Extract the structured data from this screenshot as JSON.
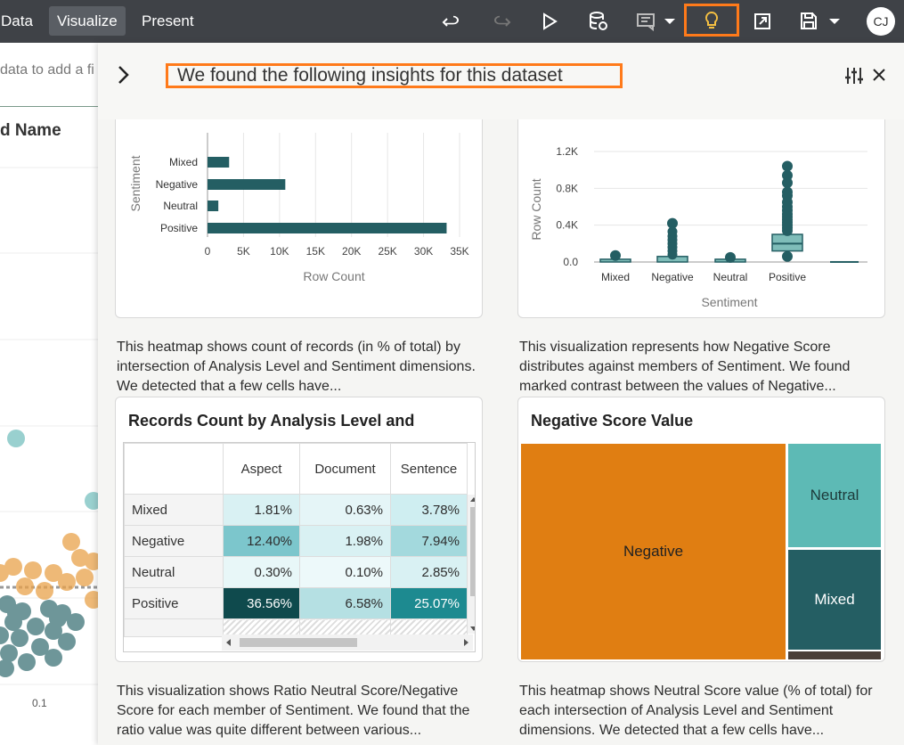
{
  "toolbar": {
    "tabs": [
      "Data",
      "Visualize",
      "Present"
    ],
    "active_tab": "Visualize",
    "buttons": [
      "undo-icon",
      "redo-icon",
      "play-icon",
      "data-refresh-icon",
      "comment-icon",
      "insights-lightbulb-icon",
      "export-icon",
      "save-icon"
    ],
    "avatar_initials": "CJ",
    "accent_color": "#ff7a1a"
  },
  "background_canvas": {
    "filter_hint": "data to add a fi",
    "chart_title": "d Name",
    "x_tick": "0.1"
  },
  "panel": {
    "title": "We found the following insights for this dataset"
  },
  "card1": {
    "ylabel": "Sentiment",
    "xlabel": "Row Count",
    "categories": [
      "Mixed",
      "Negative",
      "Neutral",
      "Positive"
    ],
    "ticks": [
      "0",
      "5K",
      "10K",
      "15K",
      "20K",
      "25K",
      "30K",
      "35K"
    ],
    "desc": "This heatmap shows count of records (in % of total) by intersection of Analysis Level and Sentiment dimensions. We detected that a few cells have..."
  },
  "card2": {
    "ylabel": "Row Count",
    "xlabel": "Sentiment",
    "categories": [
      "Mixed",
      "Negative",
      "Neutral",
      "Positive"
    ],
    "yticks": [
      "1.2K",
      "0.8K",
      "0.4K",
      "0.0"
    ],
    "desc": "This visualization represents how Negative Score distributes against members of Sentiment. We found marked contrast between the values of Negative..."
  },
  "card3": {
    "title": "Records Count by Analysis Level and",
    "columns": [
      "Aspect",
      "Document",
      "Sentence"
    ],
    "rows": [
      {
        "label": "Mixed",
        "values": [
          "1.81%",
          "0.63%",
          "3.78%"
        ]
      },
      {
        "label": "Negative",
        "values": [
          "12.40%",
          "1.98%",
          "7.94%"
        ]
      },
      {
        "label": "Neutral",
        "values": [
          "0.30%",
          "0.10%",
          "2.85%"
        ]
      },
      {
        "label": "Positive",
        "values": [
          "36.56%",
          "6.58%",
          "25.07%"
        ]
      }
    ],
    "desc": "This visualization shows Ratio Neutral Score/Negative Score for each member of Sentiment. We found that the ratio value was quite different between various..."
  },
  "card4": {
    "title": "Negative Score Value",
    "labels": [
      "Negative",
      "Neutral",
      "Mixed"
    ],
    "colors": {
      "Negative": "#e07e12",
      "Neutral": "#5dbab5",
      "Mixed": "#245e63"
    },
    "desc": "This heatmap shows Neutral Score value (% of total) for each intersection of Analysis Level and Sentiment dimensions. We detected that a few cells have..."
  },
  "chart_data": [
    {
      "type": "bar",
      "categories": [
        "Mixed",
        "Negative",
        "Neutral",
        "Positive"
      ],
      "values": [
        3000,
        10800,
        1500,
        33200
      ],
      "title": "",
      "xlabel": "Row Count",
      "ylabel": "Sentiment",
      "xlim": [
        0,
        35000
      ],
      "orientation": "horizontal",
      "color": "#245e63"
    },
    {
      "type": "scatter",
      "categories": [
        "Mixed",
        "Negative",
        "Neutral",
        "Positive"
      ],
      "medians": [
        10,
        40,
        10,
        200
      ],
      "maxima": [
        70,
        420,
        50,
        1040
      ],
      "title": "",
      "xlabel": "Sentiment",
      "ylabel": "Row Count",
      "ylim": [
        0,
        1200
      ],
      "color": "#245e63"
    }
  ]
}
